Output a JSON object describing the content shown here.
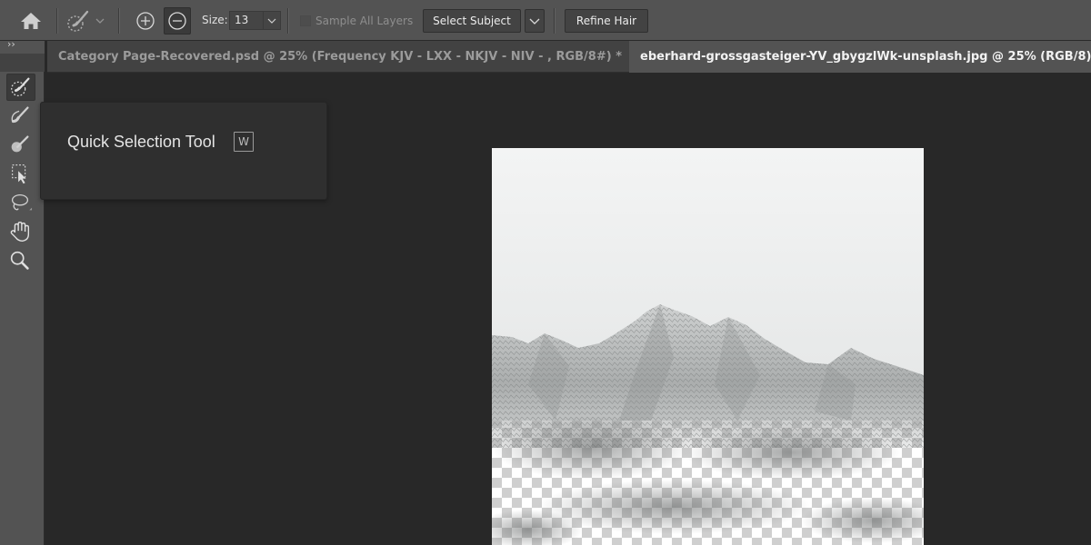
{
  "optionsbar": {
    "home_icon": "home-icon",
    "size_label": "Size:",
    "size_value": "13",
    "sample_all_layers_label": "Sample All Layers",
    "sample_all_layers_checked": false,
    "select_subject_label": "Select Subject",
    "refine_hair_label": "Refine Hair"
  },
  "tabs": [
    {
      "label": "Category Page-Recovered.psd @ 25% (Frequency  KJV  -  LXX  -  NKJV -  NIV  -     , RGB/8#) *",
      "close": "×",
      "active": false
    },
    {
      "label": "eberhard-grossgasteiger-YV_gbygzlWk-unsplash.jpg @ 25% (RGB/8)",
      "close": "×",
      "active": true
    }
  ],
  "toolbar": {
    "collapse_glyph": "››",
    "tools": [
      {
        "name": "quick-selection",
        "icon": "quick-selection-brush-icon",
        "active": true
      },
      {
        "name": "add-brush",
        "icon": "brush-add-icon",
        "active": false
      },
      {
        "name": "remove-brush",
        "icon": "brush-remove-icon",
        "active": false
      },
      {
        "name": "object-selection",
        "icon": "object-selection-icon",
        "active": false
      },
      {
        "name": "lasso",
        "icon": "lasso-icon",
        "active": false
      },
      {
        "name": "hand",
        "icon": "hand-icon",
        "active": false
      },
      {
        "name": "zoom",
        "icon": "zoom-icon",
        "active": false
      }
    ]
  },
  "tooltip": {
    "title": "Quick Selection Tool",
    "shortcut": "W"
  },
  "colors": {
    "app_bg": "#282828",
    "panel_bg": "#535353",
    "tab_bg": "#424242",
    "tooltip_bg": "#2f2f2f"
  }
}
